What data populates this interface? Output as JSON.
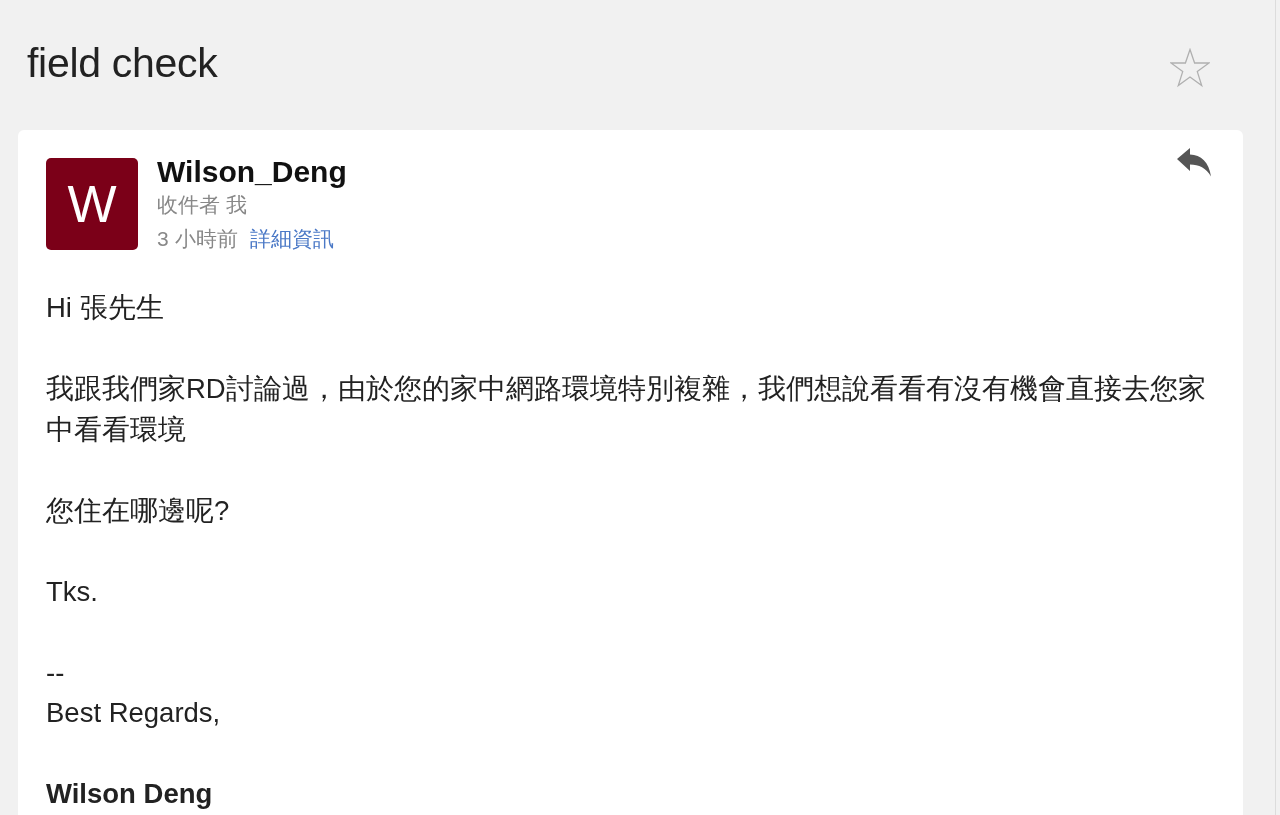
{
  "header": {
    "subject": "field check",
    "starred": false
  },
  "message": {
    "sender_initial": "W",
    "sender": "Wilson_Deng",
    "recipients": "收件者 我",
    "time": "3 小時前",
    "details_link": "詳細資訊",
    "body": [
      "Hi 張先生",
      "我跟我們家RD討論過，由於您的家中網路環境特別複雜，我們想說看看有沒有機會直接去您家中看看環境",
      "您住在哪邊呢?",
      "Tks."
    ],
    "signature": {
      "lines": [
        "--",
        "Best Regards,"
      ],
      "name": "Wilson Deng"
    }
  }
}
